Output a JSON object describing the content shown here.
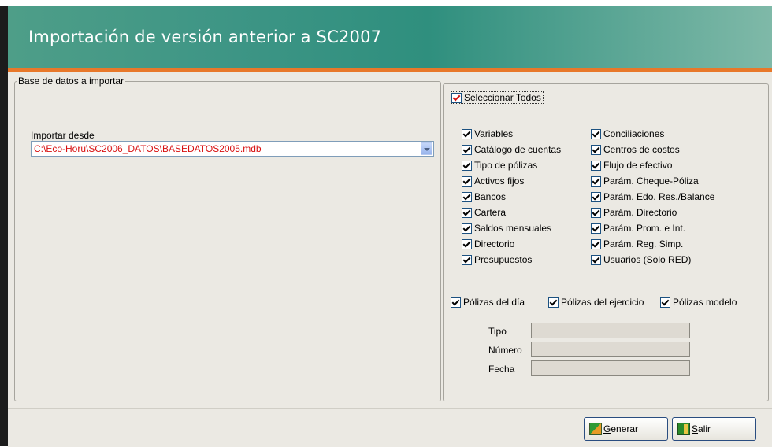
{
  "window": {
    "title": "Importación de versión anterior a SC2007"
  },
  "left_group": {
    "legend": "Base de datos a importar",
    "import_label": "Importar desde",
    "import_value": "C:\\Eco-Horu\\SC2006_DATOS\\BASEDATOS2005.mdb"
  },
  "select_all": {
    "label": "Seleccionar Todos",
    "checked": true
  },
  "col1": [
    "Variables",
    "Catálogo de cuentas",
    "Tipo de pólizas",
    "Activos fijos",
    "Bancos",
    "Cartera",
    "Saldos mensuales",
    "Directorio",
    "Presupuestos"
  ],
  "col2": [
    "Conciliaciones",
    "Centros de costos",
    "Flujo de efectivo",
    "Parám. Cheque-Póliza",
    "Parám. Edo. Res./Balance",
    "Parám. Directorio",
    "Parám. Prom. e Int.",
    "Parám. Reg. Simp.",
    "Usuarios (Solo RED)"
  ],
  "polizas": {
    "dia": "Pólizas del día",
    "ejercicio": "Pólizas del ejercicio",
    "modelo": "Pólizas modelo"
  },
  "fields": {
    "tipo": "Tipo",
    "numero": "Número",
    "fecha": "Fecha"
  },
  "buttons": {
    "generar_mnemonic": "G",
    "generar_rest": "enerar",
    "salir_mnemonic": "S",
    "salir_rest": "alir"
  },
  "colors": {
    "header": "#3d9585",
    "accent_bar": "#e8782a",
    "path_text": "#d81010",
    "panel_bg": "#ebe9e3"
  }
}
